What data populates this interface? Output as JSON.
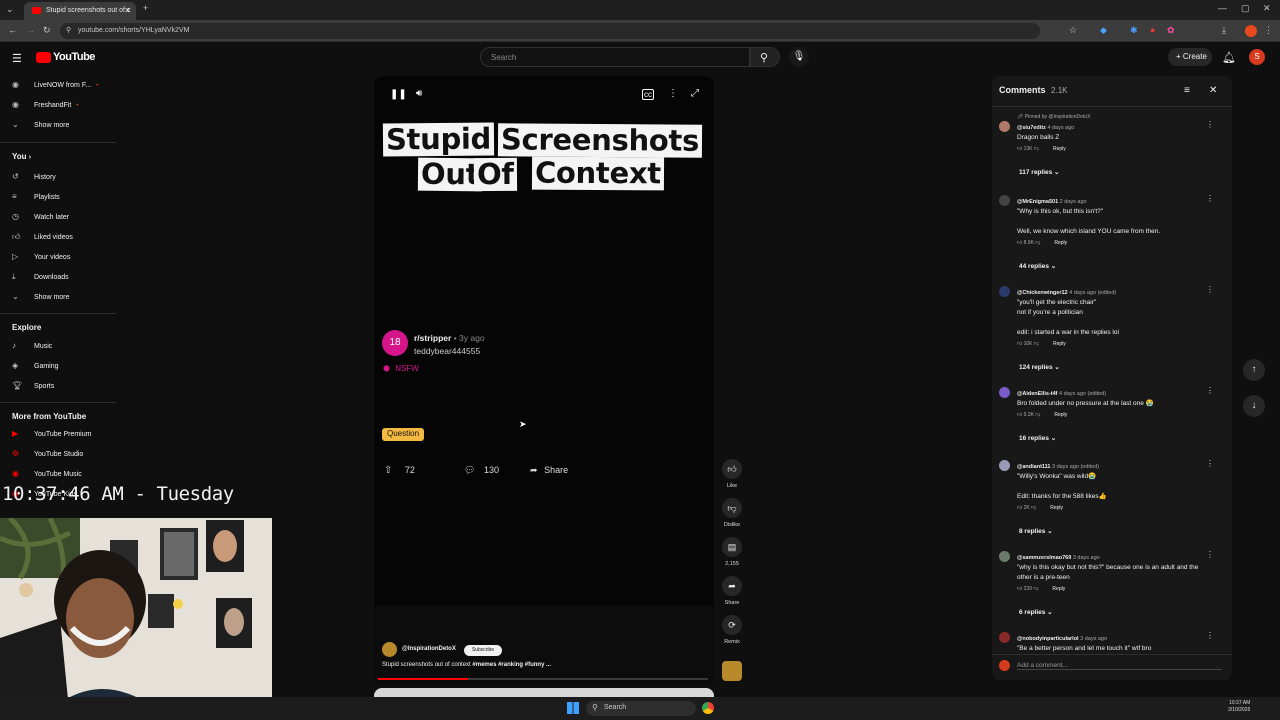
{
  "browser": {
    "tab_title": "Stupid screenshots out of c",
    "url": "youtube.com/shorts/YHLyaNVk2VM"
  },
  "masthead": {
    "logo": "YouTube",
    "search_placeholder": "Search",
    "create_label": "Create",
    "profile_initial": "S"
  },
  "sidebar": {
    "subs": [
      {
        "label": "LiveNOW from F...",
        "icon": "channel-avatar"
      },
      {
        "label": "FreshandFit",
        "icon": "channel-avatar"
      },
      {
        "label": "Show more",
        "icon": "chevron-down"
      }
    ],
    "you_header": "You",
    "you_items": [
      {
        "label": "History",
        "icon": "history-icon"
      },
      {
        "label": "Playlists",
        "icon": "playlist-icon"
      },
      {
        "label": "Watch later",
        "icon": "clock-icon"
      },
      {
        "label": "Liked videos",
        "icon": "thumb-up-icon"
      },
      {
        "label": "Your videos",
        "icon": "video-icon"
      },
      {
        "label": "Downloads",
        "icon": "download-icon"
      },
      {
        "label": "Show more",
        "icon": "chevron-down"
      }
    ],
    "explore_header": "Explore",
    "explore_items": [
      {
        "label": "Music",
        "icon": "music-icon"
      },
      {
        "label": "Gaming",
        "icon": "gaming-icon"
      },
      {
        "label": "Sports",
        "icon": "trophy-icon"
      }
    ],
    "more_header": "More from YouTube",
    "more_items": [
      {
        "label": "YouTube Premium"
      },
      {
        "label": "YouTube Studio"
      },
      {
        "label": "YouTube Music"
      },
      {
        "label": "YouTube Kids"
      }
    ]
  },
  "overlay": {
    "clock": "10:37:46 AM - Tuesday"
  },
  "short": {
    "headline_line1": [
      "Stupid",
      "Screenshots"
    ],
    "headline_line2": [
      "Out",
      "Of",
      "Context"
    ],
    "subreddit_avatar": "18",
    "subreddit": "r/stripper",
    "age": "• 3y ago",
    "poster": "teddybear444555",
    "nsfw": "NSFW",
    "flair": "Question",
    "upvotes": "72",
    "comments": "130",
    "share": "Share",
    "channel": "@InspirationDetoX",
    "subscribe": "Subscribe",
    "description": "Stupid screenshots out of context",
    "hashtags": "#memes #ranking #funny ..."
  },
  "rail": {
    "like": "Like",
    "dislike": "Dislike",
    "comment_count": "2,155",
    "share": "Share",
    "remix": "Remix"
  },
  "comments_panel": {
    "title": "Comments",
    "count": "2.1K",
    "pinned_by": "Pinned by @InspirationDetoX",
    "reply_label": "Reply",
    "add_placeholder": "Add a comment...",
    "items": [
      {
        "handle": "@siu7editz",
        "time": "4 days ago",
        "lines": [
          "Dragon balls Z"
        ],
        "likes": "13K",
        "replies": "117 replies",
        "color": "#b07a6a"
      },
      {
        "handle": "@MrEnigma501",
        "time": "2 days ago",
        "lines": [
          "\"Why is this ok, but this isn't?\"",
          "",
          "Well, we know which island YOU came from then."
        ],
        "likes": "8.9K",
        "replies": "44 replies",
        "color": "#444"
      },
      {
        "handle": "@Chickenwinger12",
        "time": "4 days ago (edited)",
        "lines": [
          "\"you'll get the electric chair\"",
          "not if you're a politician",
          "",
          "edit: i started a war in the replies lol"
        ],
        "likes": "10K",
        "replies": "124 replies",
        "color": "#2a3a6a"
      },
      {
        "handle": "@AidenEllis-t4f",
        "time": "4 days ago (edited)",
        "lines": [
          "Bro folded under no pressure at the last one 😭"
        ],
        "likes": "9.3K",
        "replies": "16 replies",
        "color": "#7a5ac8"
      },
      {
        "handle": "@andiant111",
        "time": "3 days ago (edited)",
        "lines": [
          "\"Willy's Wonka\" was wild😭",
          "",
          "Edit: thanks for the 588 likes👍"
        ],
        "likes": "2K",
        "replies": "8 replies",
        "color": "#9a9ab8"
      },
      {
        "handle": "@sammzerslmao769",
        "time": "3 days ago",
        "lines": [
          "\"why is this okay but not this?\" because one is an adult and the",
          "other is a pre-teen"
        ],
        "likes": "239",
        "replies": "6 replies",
        "color": "#6a7a6a"
      },
      {
        "handle": "@nobodyinparticularlol",
        "time": "3 days ago",
        "lines": [
          "\"Be a better person and let me touch it\" wtf bro"
        ],
        "likes": "",
        "replies": "",
        "color": "#8a2a2a"
      }
    ]
  },
  "taskbar": {
    "search": "Search",
    "time": "10:37 AM",
    "date": "3/10/2026"
  }
}
